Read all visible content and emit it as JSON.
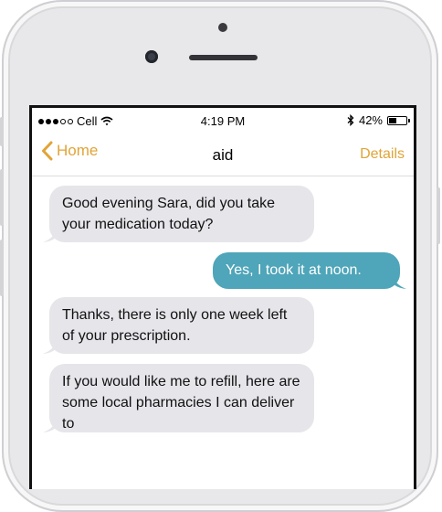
{
  "status_bar": {
    "carrier": "Cell",
    "time": "4:19 PM",
    "battery_percent": "42%",
    "signal_bars_filled": 3,
    "signal_bars_total": 5,
    "battery_level": 0.42
  },
  "nav": {
    "back_label": "Home",
    "title": "aid",
    "details_label": "Details"
  },
  "colors": {
    "accent": "#e1a436",
    "outgoing_bubble": "#4fa5b9",
    "incoming_bubble": "#e5e5ea"
  },
  "messages": [
    {
      "direction": "incoming",
      "text": "Good evening Sara, did you take your medication today?"
    },
    {
      "direction": "outgoing",
      "text": "Yes, I took it at noon."
    },
    {
      "direction": "incoming",
      "text": "Thanks, there is only one week left of your prescription."
    },
    {
      "direction": "incoming",
      "text": "If you would like me to refill, here are some local pharmacies I can deliver to"
    }
  ]
}
